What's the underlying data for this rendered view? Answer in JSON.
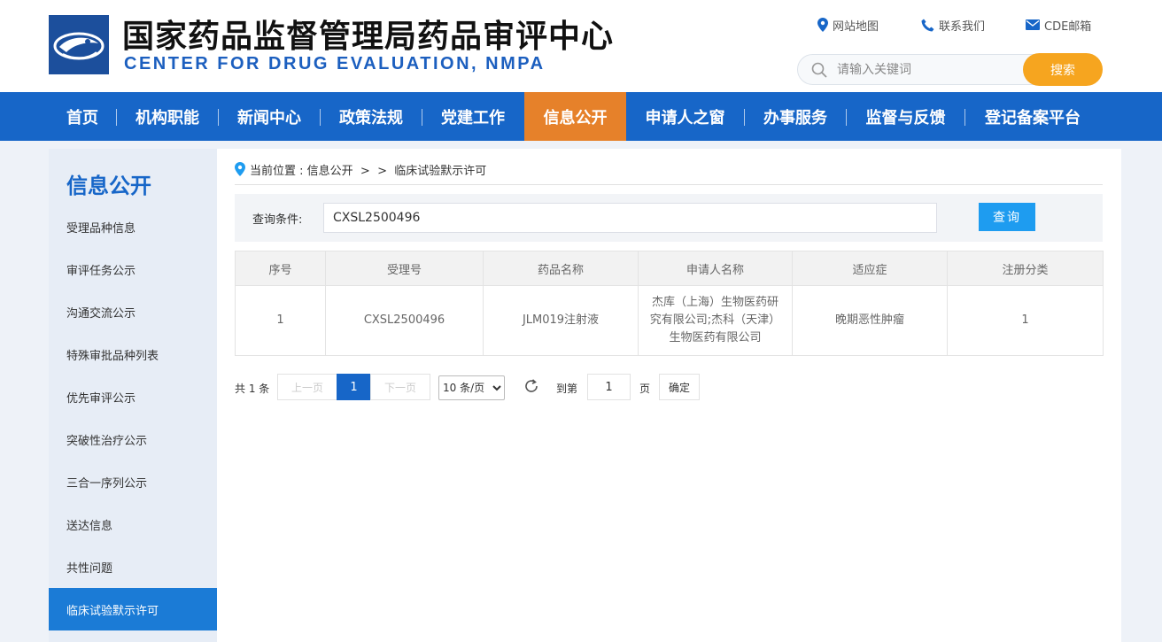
{
  "header": {
    "title_cn": "国家药品监督管理局药品审评中心",
    "title_en": "CENTER FOR DRUG EVALUATION, NMPA",
    "links": [
      {
        "label": "网站地图",
        "icon": "location-pin-icon"
      },
      {
        "label": "联系我们",
        "icon": "phone-icon"
      },
      {
        "label": "CDE邮箱",
        "icon": "mail-icon"
      }
    ],
    "search": {
      "placeholder": "请输入关键词",
      "button": "搜索"
    },
    "colors": {
      "brand": "#1766c8",
      "accent": "#e6812a",
      "search_button": "#f6a51f"
    }
  },
  "nav": {
    "items": [
      "首页",
      "机构职能",
      "新闻中心",
      "政策法规",
      "党建工作",
      "信息公开",
      "申请人之窗",
      "办事服务",
      "监督与反馈",
      "登记备案平台"
    ],
    "active": "信息公开"
  },
  "sidebar": {
    "title": "信息公开",
    "items": [
      "受理品种信息",
      "审评任务公示",
      "沟通交流公示",
      "特殊审批品种列表",
      "优先审评公示",
      "突破性治疗公示",
      "三合一序列公示",
      "送达信息",
      "共性问题",
      "临床试验默示许可"
    ],
    "active": "临床试验默示许可"
  },
  "main": {
    "breadcrumb": "当前位置 : 信息公开  >  >  临床试验默示许可",
    "query": {
      "label": "查询条件:",
      "value": "CXSL2500496",
      "button": "查询"
    },
    "table": {
      "headers": [
        "序号",
        "受理号",
        "药品名称",
        "申请人名称",
        "适应症",
        "注册分类"
      ],
      "rows": [
        [
          "1",
          "CXSL2500496",
          "JLM019注射液",
          "杰库（上海）生物医药研究有限公司;杰科（天津）生物医药有限公司",
          "晚期恶性肿瘤",
          "1"
        ]
      ]
    },
    "pager": {
      "total": "共 1 条",
      "prev": "上一页",
      "current": "1",
      "next": "下一页",
      "page_size": "10 条/页",
      "goto_label": "到第",
      "goto_value": "1",
      "page_unit": "页",
      "confirm": "确定"
    }
  }
}
